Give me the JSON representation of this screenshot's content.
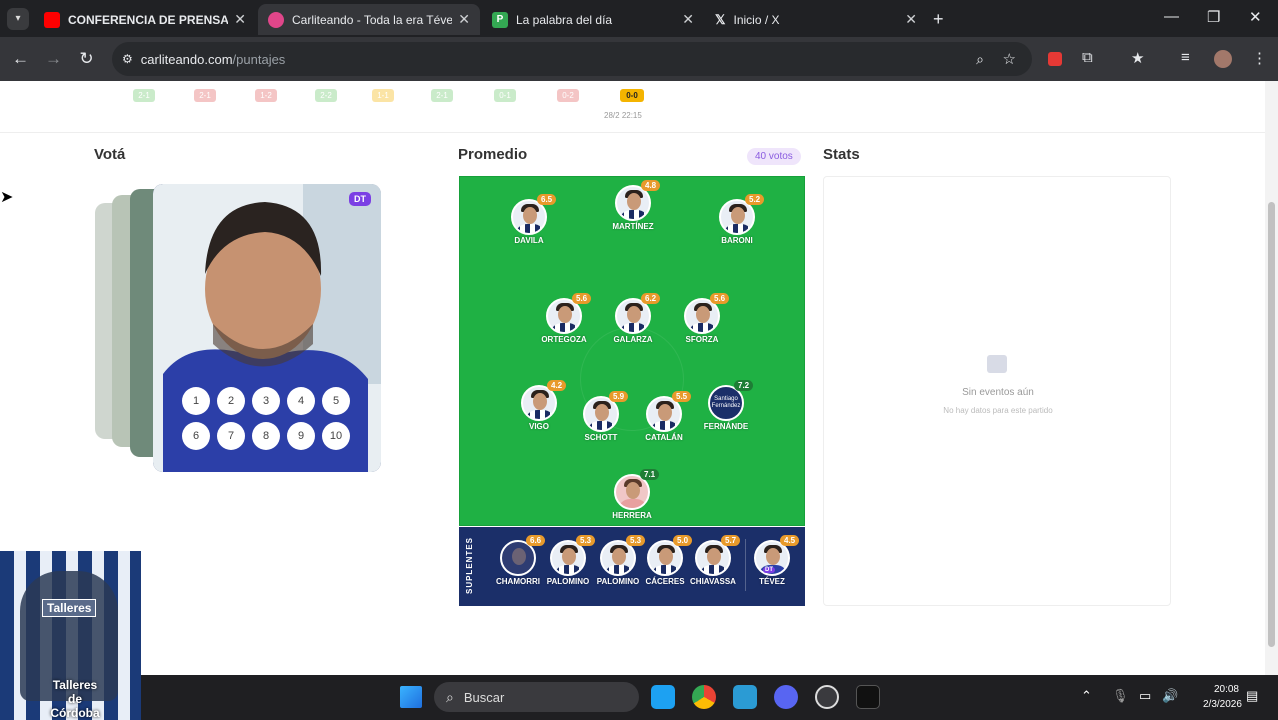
{
  "browser": {
    "tabs": [
      {
        "title": "CONFERENCIA DE PRENSA | CA",
        "favicon": "youtube-icon",
        "color": "#ff0000"
      },
      {
        "title": "Carliteando - Toda la era Tévez",
        "favicon": "carliteando-icon",
        "color": "#e0468a"
      },
      {
        "title": "La palabra del día",
        "favicon": "palabra-icon",
        "color": "#34a853"
      },
      {
        "title": "Inicio / X",
        "favicon": "x-icon",
        "color": "#ffffff"
      }
    ],
    "url_host": "carliteando.com",
    "url_path": "/puntajes"
  },
  "matches": [
    {
      "score": "2-1",
      "color": "#6bc76b"
    },
    {
      "score": "2-1",
      "color": "#e05b5b"
    },
    {
      "score": "1-2",
      "color": "#e05b5b"
    },
    {
      "score": "2-2",
      "color": "#6bc76b"
    },
    {
      "score": "1-1",
      "color": "#f4b400"
    },
    {
      "score": "2-1",
      "color": "#6bc76b"
    },
    {
      "score": "0-1",
      "color": "#6bc76b"
    },
    {
      "score": "0-2",
      "color": "#e05b5b"
    }
  ],
  "current_match": {
    "score": "0-0",
    "date": "28/2",
    "time": "22:15"
  },
  "vota": {
    "title": "Votá",
    "badge": "DT",
    "buttons": [
      "1",
      "2",
      "3",
      "4",
      "5",
      "6",
      "7",
      "8",
      "9",
      "10"
    ]
  },
  "promedio": {
    "title": "Promedio",
    "votes": "40 votos",
    "players": [
      {
        "name": "DAVILA",
        "score": "6.5"
      },
      {
        "name": "MARTÍNEZ",
        "score": "4.8"
      },
      {
        "name": "BARONI",
        "score": "5.2"
      },
      {
        "name": "ORTEGOZA",
        "score": "5.6"
      },
      {
        "name": "GALARZA",
        "score": "6.2"
      },
      {
        "name": "SFORZA",
        "score": "5.6"
      },
      {
        "name": "VIGO",
        "score": "4.2"
      },
      {
        "name": "SCHOTT",
        "score": "5.9"
      },
      {
        "name": "CATALÁN",
        "score": "5.5"
      },
      {
        "name": "FERNÁNDE",
        "score": "7.2",
        "photo_text": "Santiago Fernández"
      },
      {
        "name": "HERRERA",
        "score": "7.1"
      }
    ],
    "bench_label": "SUPLENTES",
    "bench": [
      {
        "name": "CHAMORRI",
        "score": "6.6"
      },
      {
        "name": "PALOMINO",
        "score": "5.3"
      },
      {
        "name": "PALOMINO",
        "score": "5.3"
      },
      {
        "name": "CÁCERES",
        "score": "5.0"
      },
      {
        "name": "CHIAVASSA",
        "score": "5.7"
      }
    ],
    "coach": {
      "name": "TÉVEZ",
      "score": "4.5",
      "badge": "DT"
    }
  },
  "stats": {
    "title": "Stats",
    "empty_title": "Sin eventos aún",
    "empty_sub": "No hay datos para este partido"
  },
  "webcam": {
    "logo_top": "Talleres",
    "logo_bottom": "Talleres de Córdoba"
  },
  "taskbar": {
    "search_placeholder": "Buscar",
    "time": "20:08",
    "date": "2/3/2026"
  }
}
